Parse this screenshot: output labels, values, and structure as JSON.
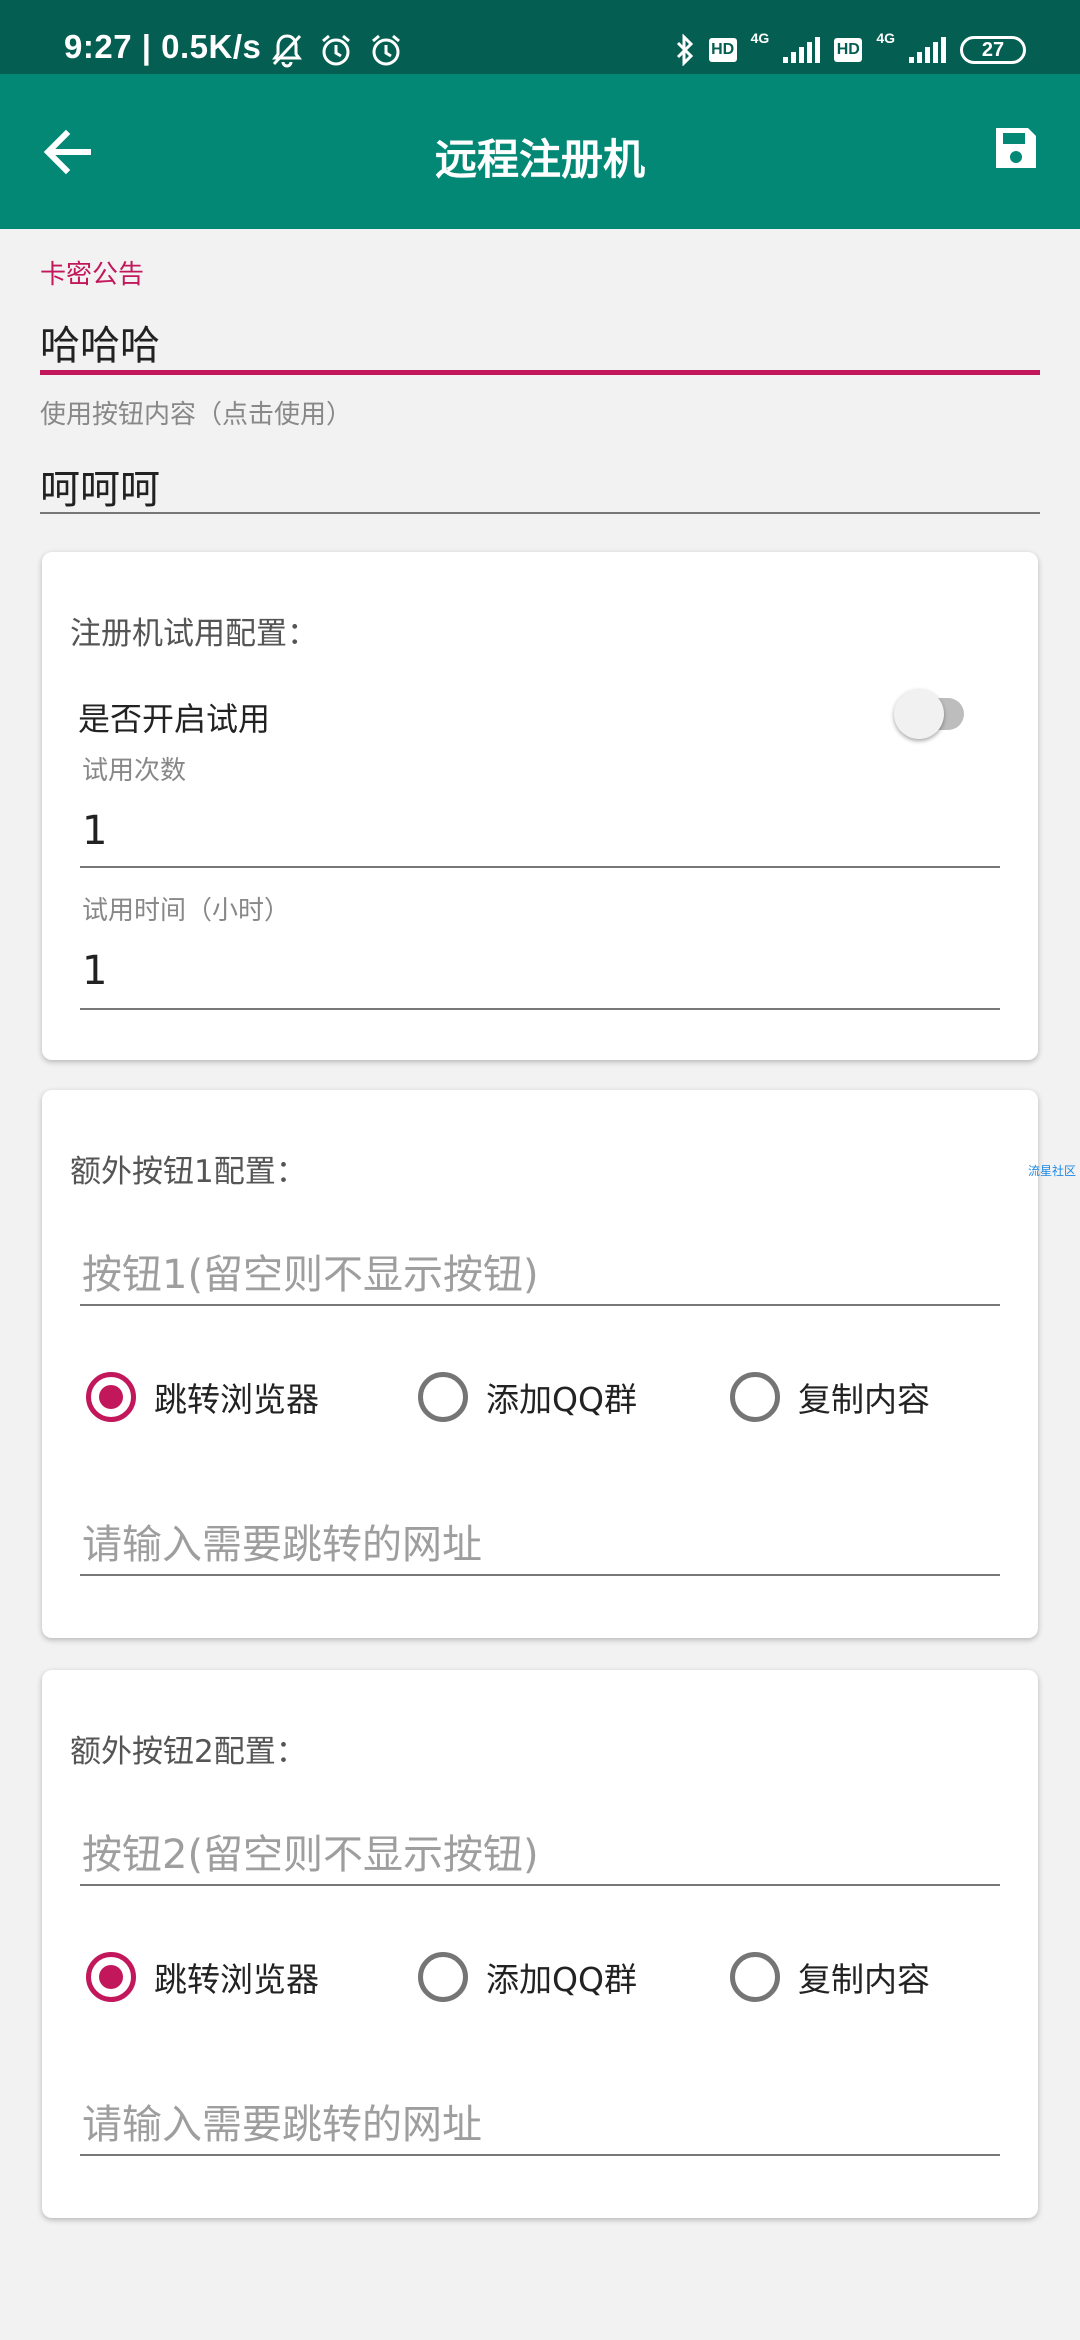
{
  "status_bar": {
    "time": "9:27 | 0.5K/s",
    "net1": "4G",
    "net2": "4G",
    "hd1": "HD",
    "hd2": "HD",
    "battery": "27",
    "icons": [
      "mute-bell-icon",
      "alarm-icon",
      "alarm-icon",
      "bluetooth-icon",
      "signal-icon",
      "battery-icon"
    ]
  },
  "appbar": {
    "title": "远程注册机",
    "back_icon": "arrow-back-icon",
    "save_icon": "save-icon",
    "color": "#038875"
  },
  "announcement": {
    "label": "卡密公告",
    "value": "哈哈哈"
  },
  "use_button": {
    "label": "使用按钮内容（点击使用）",
    "value": "呵呵呵"
  },
  "trial_card": {
    "title": "注册机试用配置：",
    "switch_label": "是否开启试用",
    "switch_on": false,
    "count_label": "试用次数",
    "count_value": "1",
    "time_label": "试用时间（小时）",
    "time_value": "1"
  },
  "button1_card": {
    "title": "额外按钮1配置：",
    "name_placeholder": "按钮1(留空则不显示按钮)",
    "options": [
      "跳转浏览器",
      "添加QQ群",
      "复制内容"
    ],
    "selected": 0,
    "url_placeholder": "请输入需要跳转的网址"
  },
  "button2_card": {
    "title": "额外按钮2配置：",
    "name_placeholder": "按钮2(留空则不显示按钮)",
    "options": [
      "跳转浏览器",
      "添加QQ群",
      "复制内容"
    ],
    "selected": 0,
    "url_placeholder": "请输入需要跳转的网址"
  },
  "watermark": "流星社区",
  "accent_color": "#c2185b"
}
